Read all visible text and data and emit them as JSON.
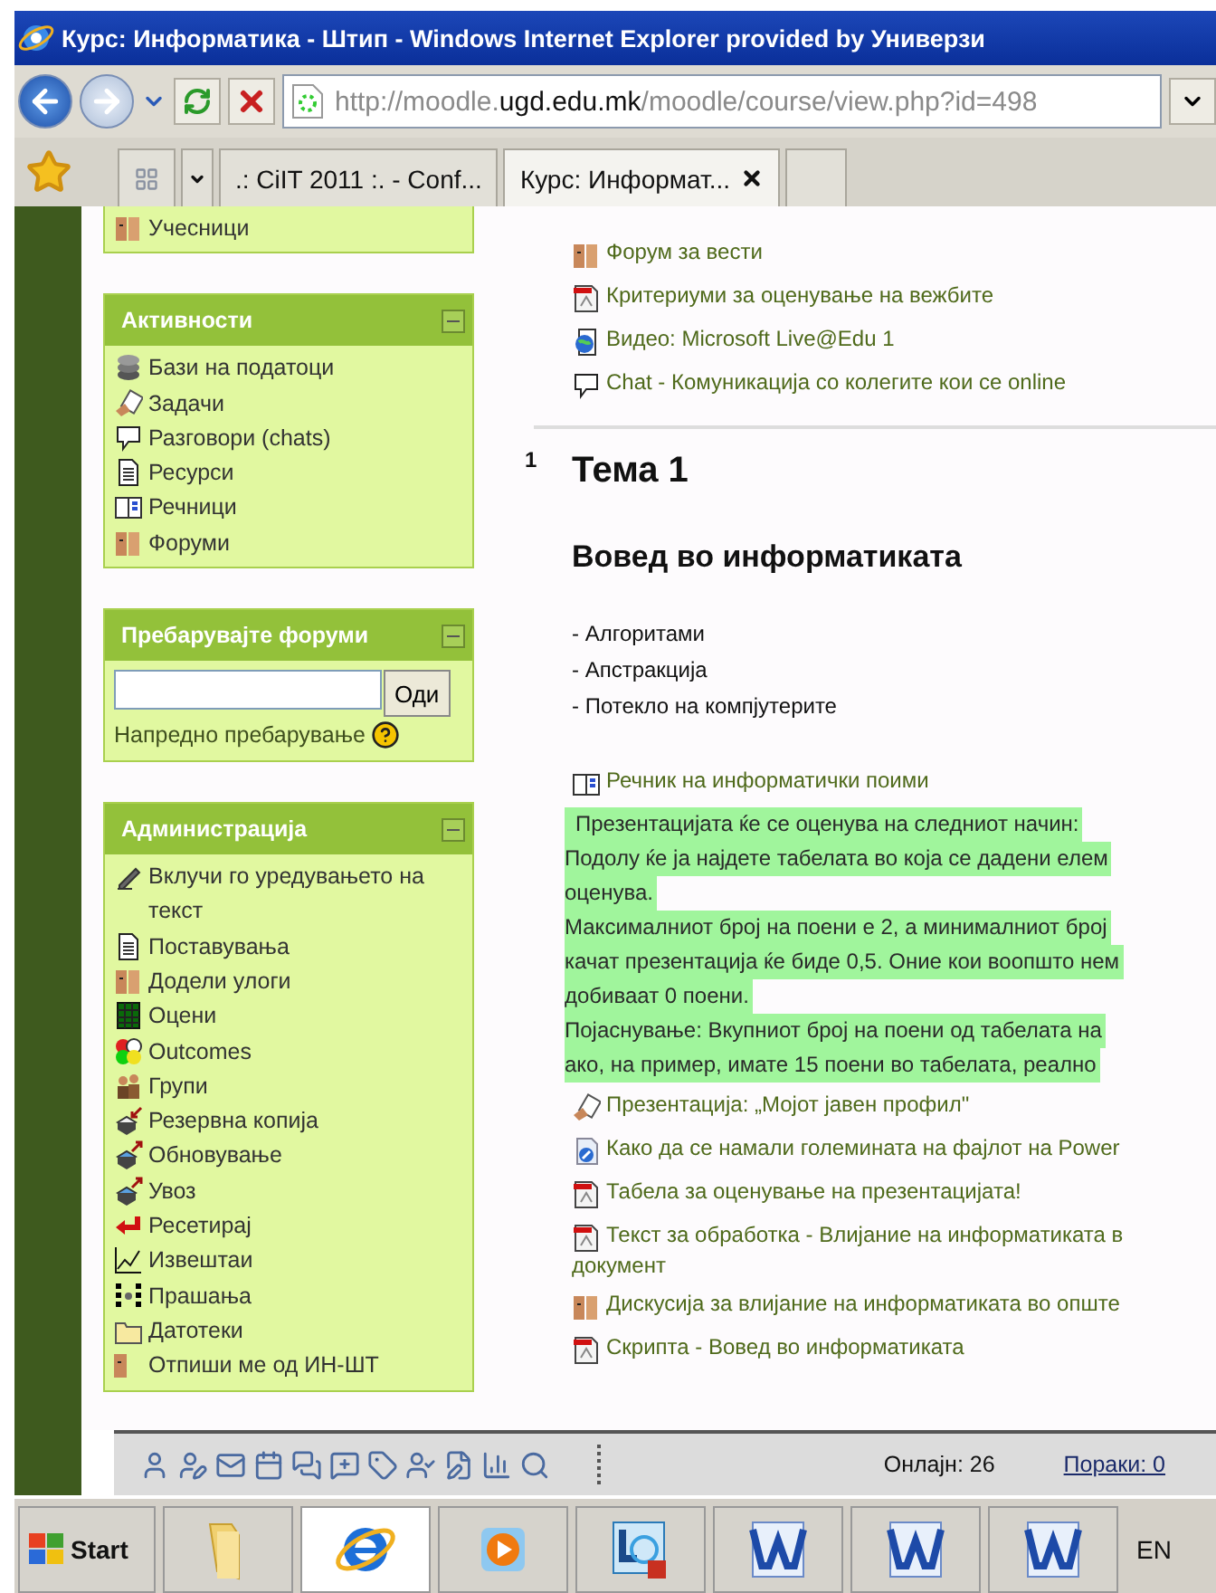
{
  "window": {
    "title": "Курс: Информатика - Штип - Windows Internet Explorer provided by Универзи"
  },
  "address_bar": {
    "url": "http://moodle.**ugd.edu.mk**/moodle/course/view.php?id=498"
  },
  "tabs": [
    {
      "label": ".: CiIT 2011 :. - Conf...",
      "selected": false
    },
    {
      "label": "Курс: Информат...",
      "selected": true
    }
  ],
  "sidebar": {
    "blocks": [
      {
        "kind": "list",
        "items": [
          {
            "kind": "participants",
            "label": "Учесници"
          }
        ]
      },
      {
        "kind": "list",
        "title": "Активности",
        "items": [
          {
            "kind": "database",
            "label": "Бази на податоци"
          },
          {
            "kind": "assignment",
            "label": "Задачи"
          },
          {
            "kind": "chat",
            "label": "Разговори (chats)"
          },
          {
            "kind": "resource",
            "label": "Ресурси"
          },
          {
            "kind": "glossary",
            "label": "Речници"
          },
          {
            "kind": "forum",
            "label": "Форуми"
          }
        ]
      },
      {
        "kind": "search",
        "title": "Пребарувајте форуми",
        "button": "Оди",
        "link": "Напредно пребарување"
      },
      {
        "kind": "list",
        "title": "Администрација",
        "items": [
          {
            "kind": "edit",
            "label": "Вклучи го уредувањето на текст"
          },
          {
            "kind": "resource",
            "label": "Поставувања"
          },
          {
            "kind": "roles",
            "label": "Додели улоги"
          },
          {
            "kind": "grades",
            "label": "Оцени"
          },
          {
            "kind": "outcomes",
            "label": "Outcomes"
          },
          {
            "kind": "groups",
            "label": "Групи"
          },
          {
            "kind": "backup",
            "label": "Резервна копија"
          },
          {
            "kind": "restore",
            "label": "Обновување"
          },
          {
            "kind": "restore",
            "label": "Увоз"
          },
          {
            "kind": "reset",
            "label": "Ресетирај"
          },
          {
            "kind": "reports",
            "label": "Извештаи"
          },
          {
            "kind": "questions",
            "label": "Прашања"
          },
          {
            "kind": "files",
            "label": "Датотеки"
          },
          {
            "kind": "unenrol",
            "label": "Отпиши ме од ИН-ШТ"
          }
        ]
      }
    ]
  },
  "main": {
    "sections": [
      {
        "items": [
          {
            "kind": "forum",
            "label": "Форум за вести"
          },
          {
            "kind": "pdf",
            "label": "Критериуми за оценување на вежбите"
          },
          {
            "kind": "video",
            "label": "Видео: Microsoft Live@Edu 1"
          },
          {
            "kind": "chat",
            "label": "Chat - Комуникација со колегите кои се online"
          }
        ]
      },
      {
        "number": "1",
        "title": "Тема 1",
        "heading": "Вовед во информатиката",
        "lines": [
          "- Алгоритами",
          "- Апстракција",
          "- Потекло на компјутерите"
        ],
        "items": [
          {
            "kind": "glossary",
            "label": "Речник на информатички поими"
          },
          {
            "kind": "note",
            "lines": [
              "Презентацијата ќе се оценува на следниот начин:",
              "Подолу ќе ја најдете табелата во која се дадени елем",
              "оценува.",
              "Максималниот број на поени е 2, а минималниот број",
              "качат презентација ќе биде 0,5. Оние кои воопшто нем",
              "добиваат 0 поени.",
              "Појаснување: Вкупниот број на поени од табелата на",
              "ако, на пример, имате 15 поени во табелата, реално"
            ]
          },
          {
            "kind": "assignment",
            "label": "Презентација: „Мојот јавен профил\""
          },
          {
            "kind": "link",
            "label": "Како да се намали големината на фајлот на Power"
          },
          {
            "kind": "pdf",
            "label": "Табела за оценување на презентацијата!"
          },
          {
            "kind": "pdf",
            "label": "Текст за обработка - Влијание на информатиката в",
            "continuation": "документ"
          },
          {
            "kind": "forum",
            "label": "Дискусија за влијание на информатиката во опште"
          },
          {
            "kind": "pdf",
            "label": "Скрипта - Вовед во информатиката"
          }
        ]
      }
    ]
  },
  "chat_bar": {
    "online": "Онлајн: 26",
    "messages": "Пораки: 0"
  },
  "taskbar": {
    "start": "Start",
    "apps": [
      {
        "kind": "folder",
        "selected": false
      },
      {
        "kind": "browser",
        "selected": true
      },
      {
        "kind": "player",
        "selected": false
      },
      {
        "kind": "lync",
        "selected": false
      },
      {
        "kind": "word",
        "selected": false
      },
      {
        "kind": "word",
        "selected": false
      },
      {
        "kind": "word",
        "selected": false
      }
    ],
    "language": "EN"
  }
}
